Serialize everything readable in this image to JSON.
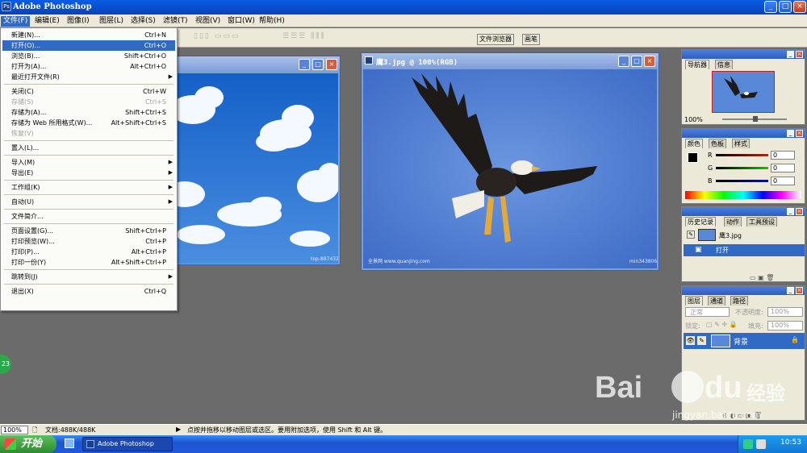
{
  "window": {
    "title": "Adobe Photoshop",
    "app_icon": "photoshop-icon"
  },
  "menubar": {
    "items": [
      "文件(F)",
      "编辑(E)",
      "图像(I)",
      "图层(L)",
      "选择(S)",
      "滤镜(T)",
      "视图(V)",
      "窗口(W)",
      "帮助(H)"
    ]
  },
  "optbar": {
    "tab1": "文件浏览器",
    "tab2": "画笔"
  },
  "file_menu": {
    "items": [
      {
        "label": "新建(N)...",
        "shortcut": "Ctrl+N",
        "state": "normal"
      },
      {
        "label": "打开(O)...",
        "shortcut": "Ctrl+O",
        "state": "selected"
      },
      {
        "label": "浏览(B)...",
        "shortcut": "Shift+Ctrl+O",
        "state": "normal"
      },
      {
        "label": "打开为(A)...",
        "shortcut": "Alt+Ctrl+O",
        "state": "normal"
      },
      {
        "label": "最近打开文件(R)",
        "shortcut": "",
        "state": "submenu"
      },
      {
        "sep": true
      },
      {
        "label": "关闭(C)",
        "shortcut": "Ctrl+W",
        "state": "normal"
      },
      {
        "label": "存储(S)",
        "shortcut": "Ctrl+S",
        "state": "disabled"
      },
      {
        "label": "存储为(A)...",
        "shortcut": "Shift+Ctrl+S",
        "state": "normal"
      },
      {
        "label": "存储为 Web 所用格式(W)...",
        "shortcut": "Alt+Shift+Ctrl+S",
        "state": "normal"
      },
      {
        "label": "恢复(V)",
        "shortcut": "",
        "state": "disabled"
      },
      {
        "sep": true
      },
      {
        "label": "置入(L)...",
        "shortcut": "",
        "state": "normal"
      },
      {
        "sep": true
      },
      {
        "label": "导入(M)",
        "shortcut": "",
        "state": "submenu"
      },
      {
        "label": "导出(E)",
        "shortcut": "",
        "state": "submenu"
      },
      {
        "sep": true
      },
      {
        "label": "工作组(K)",
        "shortcut": "",
        "state": "submenu"
      },
      {
        "sep": true
      },
      {
        "label": "自动(U)",
        "shortcut": "",
        "state": "submenu"
      },
      {
        "sep": true
      },
      {
        "label": "文件简介...",
        "shortcut": "",
        "state": "normal"
      },
      {
        "sep": true
      },
      {
        "label": "页面设置(G)...",
        "shortcut": "Shift+Ctrl+P",
        "state": "normal"
      },
      {
        "label": "打印预览(W)...",
        "shortcut": "Ctrl+P",
        "state": "normal"
      },
      {
        "label": "打印(P)...",
        "shortcut": "Alt+Ctrl+P",
        "state": "normal"
      },
      {
        "label": "打印一份(Y)",
        "shortcut": "Alt+Shift+Ctrl+P",
        "state": "normal"
      },
      {
        "sep": true
      },
      {
        "label": "跳转到(J)",
        "shortcut": "",
        "state": "submenu"
      },
      {
        "sep": true
      },
      {
        "label": "退出(X)",
        "shortcut": "Ctrl+Q",
        "state": "normal"
      }
    ]
  },
  "doc1": {
    "watermark": "top-887432"
  },
  "doc2": {
    "title": "鹰3.jpg @ 100%(RGB)",
    "watermark_left": "全景网 www.quanjing.com",
    "watermark_right": "min343806"
  },
  "navigator": {
    "tab1": "导航器",
    "tab2": "信息",
    "zoom": "100%"
  },
  "color_panel": {
    "tab1": "颜色",
    "tab2": "色板",
    "tab3": "样式",
    "r_label": "R",
    "g_label": "G",
    "b_label": "B",
    "r": "0",
    "g": "0",
    "b": "0"
  },
  "history": {
    "tab1": "历史记录",
    "tab2": "动作",
    "tab3": "工具预设",
    "snapshot": "鹰3.jpg",
    "step": "打开"
  },
  "layers": {
    "tab1": "图层",
    "tab2": "通道",
    "tab3": "路径",
    "blend": "正常",
    "opacity_label": "不透明度:",
    "opacity": "100%",
    "lock_label": "锁定:",
    "fill_label": "填充:",
    "fill": "100%",
    "layer_name": "背景"
  },
  "statusbar": {
    "zoom": "100%",
    "doc": "文档:488K/488K",
    "hint": "点按并拖移以移动图层或选区。要用附加选项，使用 Shift 和 Alt 键。"
  },
  "badge": {
    "text": "23"
  },
  "taskbar": {
    "start": "开始",
    "task": "Adobe Photoshop",
    "time": "10:53"
  },
  "brand": {
    "logo": "Bai",
    "logo2": "du",
    "cn": "经验",
    "url": "jingyan.baidu.com"
  }
}
